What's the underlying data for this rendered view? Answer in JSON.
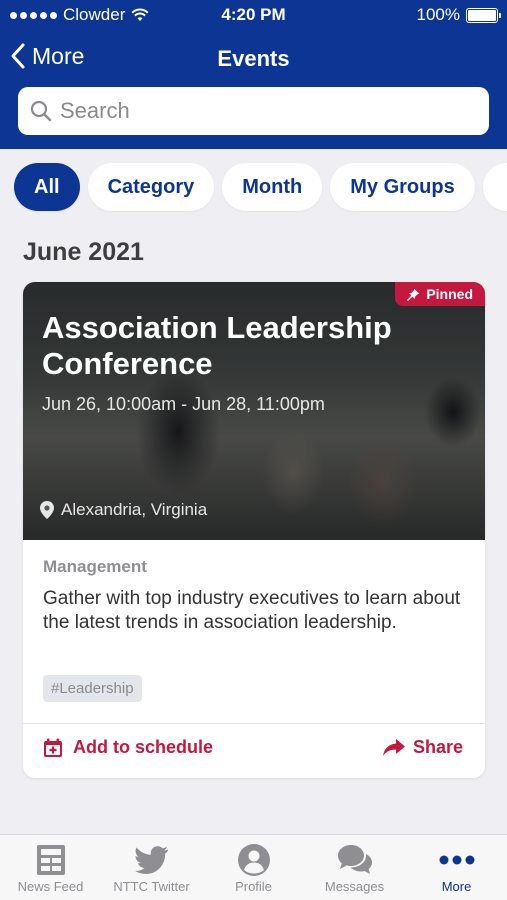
{
  "status_bar": {
    "carrier": "Clowder",
    "time": "4:20 PM",
    "battery": "100%"
  },
  "nav": {
    "back_label": "More",
    "title": "Events"
  },
  "search": {
    "placeholder": "Search",
    "value": ""
  },
  "filters": [
    {
      "label": "All",
      "active": true
    },
    {
      "label": "Category",
      "active": false
    },
    {
      "label": "Month",
      "active": false
    },
    {
      "label": "My Groups",
      "active": false
    }
  ],
  "month_header": "June 2021",
  "event": {
    "pinned_label": "Pinned",
    "title": "Association Leadership Conference",
    "date_range": "Jun 26, 10:00am - Jun 28, 11:00pm",
    "location": "Alexandria, Virginia",
    "category": "Management",
    "description": "Gather with top industry executives to learn about the latest trends in association leadership.",
    "tag": "#Leadership",
    "add_label": "Add to schedule",
    "share_label": "Share"
  },
  "tabs": [
    {
      "label": "News Feed",
      "icon": "news-feed-icon",
      "active": false
    },
    {
      "label": "NTTC Twitter",
      "icon": "twitter-icon",
      "active": false
    },
    {
      "label": "Profile",
      "icon": "profile-icon",
      "active": false
    },
    {
      "label": "Messages",
      "icon": "messages-icon",
      "active": false
    },
    {
      "label": "More",
      "icon": "more-icon",
      "active": true
    }
  ],
  "colors": {
    "brand": "#0d3594",
    "accent": "#c4183f",
    "background": "#eeeef3"
  }
}
